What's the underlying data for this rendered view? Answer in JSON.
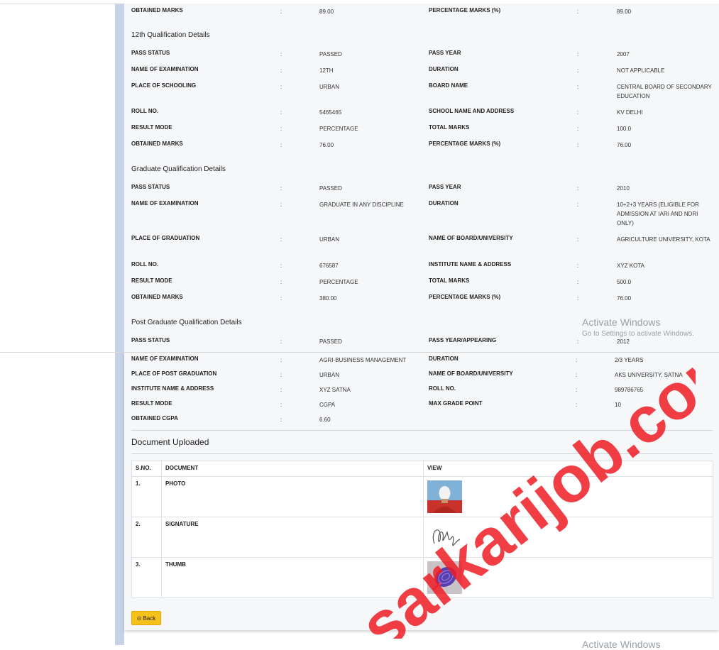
{
  "sections": {
    "s10_tail": {
      "rows": [
        [
          "OBTAINED MARKS",
          "89.00",
          "PERCENTAGE MARKS (%)",
          "89.00"
        ]
      ]
    },
    "s12": {
      "title": "12th Qualification Details",
      "rows": [
        [
          "PASS STATUS",
          "PASSED",
          "PASS YEAR",
          "2007"
        ],
        [
          "NAME OF EXAMINATION",
          "12TH",
          "DURATION",
          "NOT APPLICABLE"
        ],
        [
          "PLACE OF SCHOOLING",
          "URBAN",
          "BOARD NAME",
          "CENTRAL BOARD OF SECONDARY EDUCATION"
        ],
        [
          "ROLL NO.",
          "5465465",
          "SCHOOL NAME AND ADDRESS",
          "KV DELHI"
        ],
        [
          "RESULT MODE",
          "PERCENTAGE",
          "TOTAL MARKS",
          "100.0"
        ],
        [
          "OBTAINED MARKS",
          "76.00",
          "PERCENTAGE MARKS (%)",
          "76.00"
        ]
      ]
    },
    "grad": {
      "title": "Graduate Qualification Details",
      "rows": [
        [
          "PASS STATUS",
          "PASSED",
          "PASS YEAR",
          "2010"
        ],
        [
          "NAME OF EXAMINATION",
          "GRADUATE IN ANY DISCIPLINE",
          "DURATION",
          "10+2+3 YEARS (ELIGIBLE FOR ADMISSION AT IARI AND NDRI ONLY)"
        ],
        [
          "PLACE OF GRADUATION",
          "URBAN",
          "NAME OF BOARD/UNIVERSITY",
          "AGRICULTURE UNIVERSITY, KOTA"
        ],
        [
          "ROLL NO.",
          "676587",
          "INSTITUTE NAME & ADDRESS",
          "XYZ KOTA"
        ],
        [
          "RESULT MODE",
          "PERCENTAGE",
          "TOTAL MARKS",
          "500.0"
        ],
        [
          "OBTAINED MARKS",
          "380.00",
          "PERCENTAGE MARKS (%)",
          "76.00"
        ]
      ]
    },
    "pg": {
      "title": "Post Graduate Qualification Details",
      "rows_top": [
        [
          "PASS STATUS",
          "PASSED",
          "PASS YEAR/APPEARING",
          "2012"
        ]
      ],
      "rows_bottom": [
        [
          "NAME OF EXAMINATION",
          "AGRI-BUSINESS MANAGEMENT",
          "DURATION",
          "2/3 YEARS"
        ],
        [
          "PLACE OF POST GRADUATION",
          "URBAN",
          "NAME OF BOARD/UNIVERSITY",
          "AKS UNIVERSITY, SATNA"
        ],
        [
          "INSTITUTE NAME & ADDRESS",
          "XYZ SATNA",
          "ROLL NO.",
          "989786765"
        ],
        [
          "RESULT MODE",
          "CGPA",
          "MAX GRADE POINT",
          "10"
        ],
        [
          "OBTAINED CGPA",
          "6.60",
          "",
          ""
        ]
      ]
    }
  },
  "colon": ":",
  "documents": {
    "title": "Document Uploaded",
    "headers": [
      "S.NO.",
      "DOCUMENT",
      "VIEW"
    ],
    "rows": [
      {
        "sno": "1.",
        "name": "PHOTO",
        "icon": "photo-thumbnail"
      },
      {
        "sno": "2.",
        "name": "SIGNATURE",
        "icon": "signature-thumbnail"
      },
      {
        "sno": "3.",
        "name": "THUMB",
        "icon": "thumbprint-thumbnail"
      }
    ]
  },
  "back_button": {
    "label": "Back",
    "icon": "back-arrow-icon"
  },
  "overlay": {
    "activate_title": "Activate Windows",
    "activate_sub": "Go to Settings to activate Windows.",
    "activate_bottom": "Activate Windows",
    "watermark": "sarkarijob.com"
  },
  "colors": {
    "panel": "#f6f7f9",
    "sidebar": "#c6d2e6",
    "button": "#f7c11c",
    "watermark": "#ee1c24"
  }
}
